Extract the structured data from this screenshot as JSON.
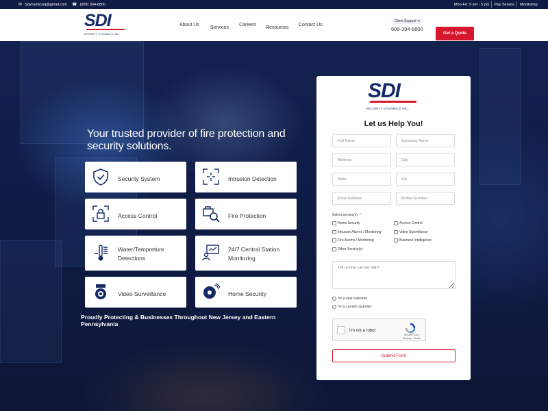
{
  "topbar": {
    "email": "Sdynamicsnj@gmail.com",
    "phone": "(609) 394-8800",
    "hours": "Mon-Fri: 9 am - 5 pm",
    "pay_service": "Pay Service",
    "monitoring": "Monitoring"
  },
  "brand": {
    "name": "SDI",
    "tagline": "SECURITY DYNAMICS INC.",
    "primary_color": "#142a66",
    "accent_color": "#d6172e"
  },
  "nav": {
    "items": [
      "About Us",
      "Services",
      "Careers",
      "Resources",
      "Contact Us"
    ]
  },
  "header": {
    "client_support": "Client Support",
    "phone": "609-394-8800",
    "quote_button": "Get a Quote"
  },
  "hero": {
    "title": "Your trusted provider of fire protection and security solutions.",
    "footer": "Proudly Protecting & Businesses Throughout New Jersey and Eastern Pennsylvania",
    "services": [
      {
        "label": "Security System",
        "icon": "shield-check-icon"
      },
      {
        "label": "Intrusion Detection",
        "icon": "crosshair-frame-icon"
      },
      {
        "label": "Access Control",
        "icon": "lock-frame-icon"
      },
      {
        "label": "Fire Protection",
        "icon": "fire-truck-search-icon"
      },
      {
        "label": "Water/Tempreture Detections",
        "icon": "thermometer-icon"
      },
      {
        "label": "24/7 Central Station Monitoring",
        "icon": "monitor-person-icon"
      },
      {
        "label": "Video Surveillance",
        "icon": "camera-icon"
      },
      {
        "label": "Home Security",
        "icon": "alarm-bell-icon"
      }
    ]
  },
  "form": {
    "title": "Let us Help You!",
    "fields": {
      "full_name": "Full Name",
      "company_name": "Company Name",
      "address": "Address",
      "city": "City",
      "state": "State",
      "zip": "Zip",
      "email": "Email Address",
      "mobile": "Mobile Number"
    },
    "services_label": "Select service(s)",
    "services_required_mark": "*",
    "service_options": [
      "Home Security",
      "Access Control",
      "Intrusion Alarms / Monitoring",
      "Video Surveillance",
      "Fire Alarms / Monitoring",
      "Business Intelligence",
      "Other Service(s)"
    ],
    "message_placeholder": "Tell us how can we help?",
    "customer_options": [
      "I'm a new customer",
      "I'm a current customer"
    ],
    "captcha_label": "I'm not a robot",
    "captcha_brand": "reCAPTCHA",
    "captcha_links": "Privacy - Terms",
    "submit": "Submit Form"
  }
}
